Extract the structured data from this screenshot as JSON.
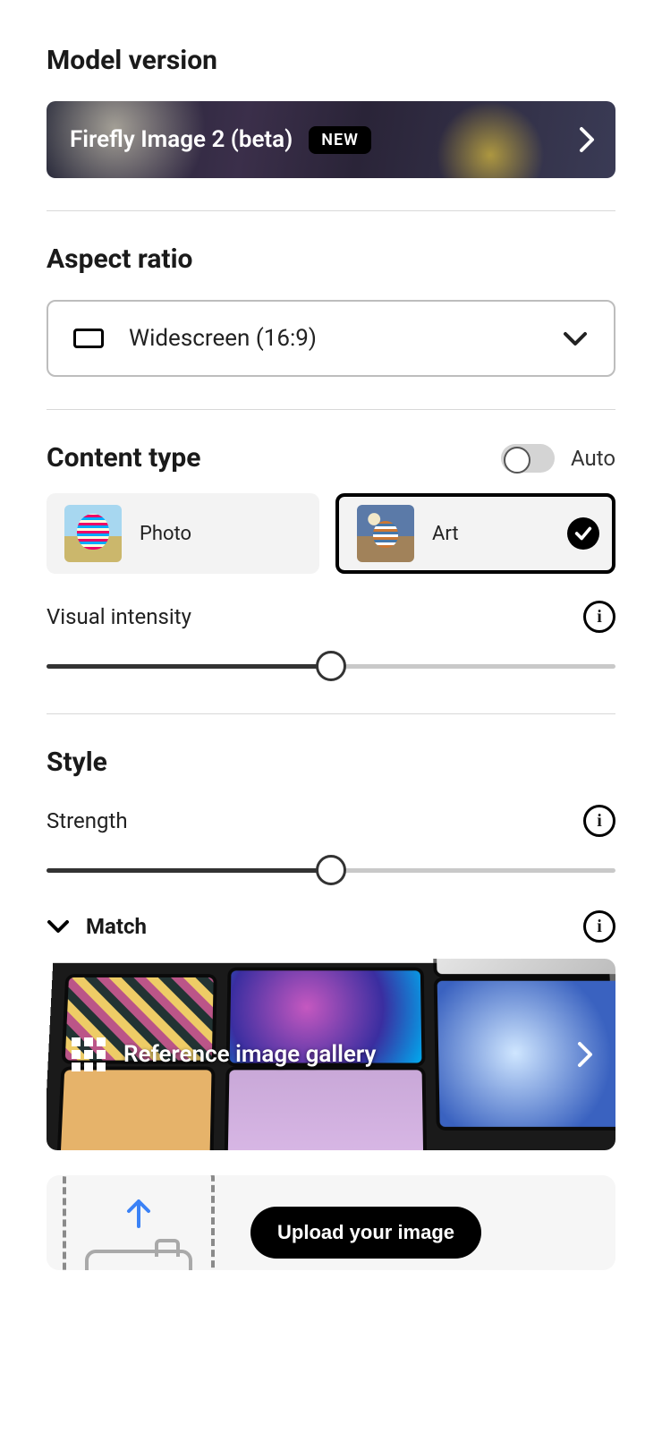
{
  "model_version": {
    "heading": "Model version",
    "name": "Firefly Image 2 (beta)",
    "badge": "NEW"
  },
  "aspect_ratio": {
    "heading": "Aspect ratio",
    "selected": "Widescreen (16:9)"
  },
  "content_type": {
    "heading": "Content type",
    "auto_label": "Auto",
    "auto_on": false,
    "options": [
      {
        "label": "Photo",
        "selected": false
      },
      {
        "label": "Art",
        "selected": true
      }
    ],
    "visual_intensity_label": "Visual intensity",
    "visual_intensity_value": 50
  },
  "style": {
    "heading": "Style",
    "strength_label": "Strength",
    "strength_value": 50,
    "match_label": "Match",
    "gallery_label": "Reference image gallery",
    "upload_label": "Upload your image"
  }
}
